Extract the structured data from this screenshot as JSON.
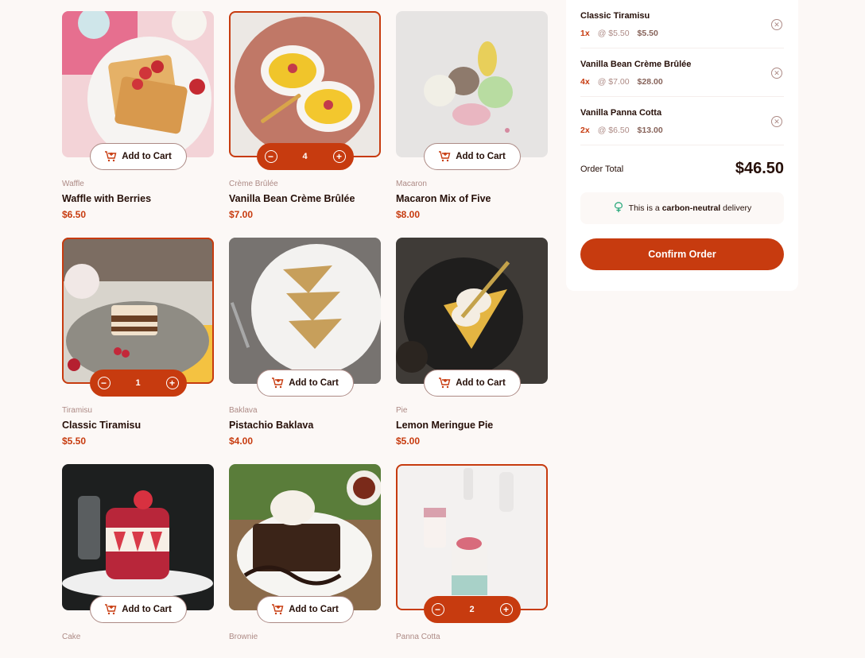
{
  "colors": {
    "accent": "#c73b0f",
    "background": "#fcf8f6",
    "text": "#260f08",
    "muted": "#87635a",
    "light": "#ad8a85"
  },
  "products": [
    {
      "category": "Waffle",
      "name": "Waffle with Berries",
      "price": "$6.50",
      "button_label": "Add to Cart",
      "selected": false,
      "qty": null,
      "photo_icon": "waffle-photo"
    },
    {
      "category": "Crème Brûlée",
      "name": "Vanilla Bean Crème Brûlée",
      "price": "$7.00",
      "button_label": "Add to Cart",
      "selected": true,
      "qty": "4",
      "photo_icon": "creme-brulee-photo"
    },
    {
      "category": "Macaron",
      "name": "Macaron Mix of Five",
      "price": "$8.00",
      "button_label": "Add to Cart",
      "selected": false,
      "qty": null,
      "photo_icon": "macaron-photo"
    },
    {
      "category": "Tiramisu",
      "name": "Classic Tiramisu",
      "price": "$5.50",
      "button_label": "Add to Cart",
      "selected": true,
      "qty": "1",
      "photo_icon": "tiramisu-photo"
    },
    {
      "category": "Baklava",
      "name": "Pistachio Baklava",
      "price": "$4.00",
      "button_label": "Add to Cart",
      "selected": false,
      "qty": null,
      "photo_icon": "baklava-photo"
    },
    {
      "category": "Pie",
      "name": "Lemon Meringue Pie",
      "price": "$5.00",
      "button_label": "Add to Cart",
      "selected": false,
      "qty": null,
      "photo_icon": "pie-photo"
    },
    {
      "category": "Cake",
      "name": "",
      "price": "",
      "button_label": "Add to Cart",
      "selected": false,
      "qty": null,
      "photo_icon": "cake-photo"
    },
    {
      "category": "Brownie",
      "name": "",
      "price": "",
      "button_label": "Add to Cart",
      "selected": false,
      "qty": null,
      "photo_icon": "brownie-photo"
    },
    {
      "category": "Panna Cotta",
      "name": "",
      "price": "",
      "button_label": "Add to Cart",
      "selected": true,
      "qty": "2",
      "photo_icon": "panna-cotta-photo"
    }
  ],
  "cart": {
    "items": [
      {
        "name": "Classic Tiramisu",
        "qty": "1x",
        "unit": "@ $5.50",
        "total": "$5.50"
      },
      {
        "name": "Vanilla Bean Crème Brûlée",
        "qty": "4x",
        "unit": "@ $7.00",
        "total": "$28.00"
      },
      {
        "name": "Vanilla Panna Cotta",
        "qty": "2x",
        "unit": "@ $6.50",
        "total": "$13.00"
      }
    ],
    "order_total_label": "Order Total",
    "order_total_value": "$46.50",
    "carbon_prefix": "This is a ",
    "carbon_bold": "carbon-neutral",
    "carbon_suffix": " delivery",
    "confirm_label": "Confirm Order"
  }
}
